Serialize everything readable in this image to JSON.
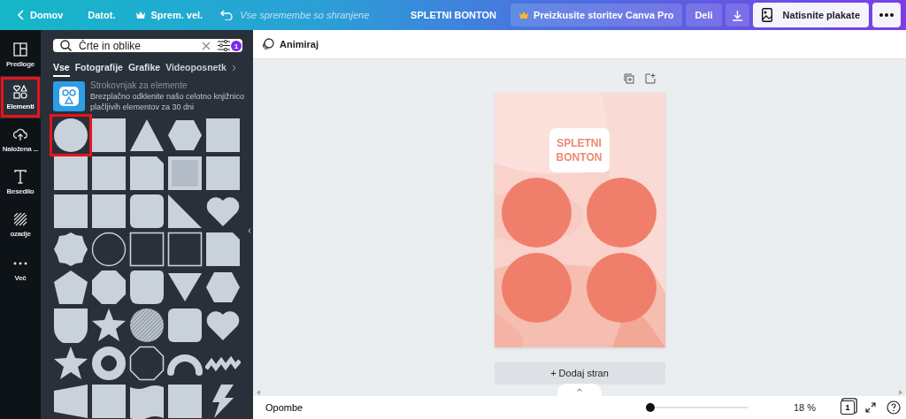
{
  "top_bar": {
    "back": "Domov",
    "file": "Datot.",
    "resize": "Sprem. vel.",
    "save_status": "Vse spremembe so shranjene",
    "design_title": "SPLETNI BONTON",
    "pro_button": "Preizkusite storitev Canva Pro",
    "share_button": "Deli",
    "print_button": "Natisnite plakate"
  },
  "sidebar": {
    "items": [
      {
        "label": "Predloge",
        "selected": false,
        "highlighted": false
      },
      {
        "label": "Elementi",
        "selected": true,
        "highlighted": true
      },
      {
        "label": "Naložena ...",
        "selected": false,
        "highlighted": false
      },
      {
        "label": "Besedilo",
        "selected": false,
        "highlighted": false
      },
      {
        "label": "ozadje",
        "selected": false,
        "highlighted": false
      },
      {
        "label": "Več",
        "selected": false,
        "highlighted": false
      }
    ]
  },
  "elements_panel": {
    "search": {
      "value": "Črte in oblike",
      "filter_count": "1"
    },
    "tabs": [
      {
        "label": "Vse",
        "selected": true
      },
      {
        "label": "Fotografije",
        "selected": false
      },
      {
        "label": "Grafike",
        "selected": false
      },
      {
        "label": "Videoposnetk",
        "selected": false
      }
    ],
    "promo": {
      "title": "Strokovnjak za elemente",
      "text": "Brezplačno odklenite našo celotno knjižnico plačljivih elementov za 30 dni"
    },
    "shapes": [
      {
        "kind": "circle",
        "highlighted": true
      },
      {
        "kind": "square",
        "highlighted": false
      },
      {
        "kind": "triangle",
        "highlighted": false
      },
      {
        "kind": "hexagon",
        "highlighted": false
      },
      {
        "kind": "square",
        "highlighted": false
      },
      {
        "kind": "square",
        "highlighted": false
      },
      {
        "kind": "square",
        "highlighted": false
      },
      {
        "kind": "folded",
        "highlighted": false
      },
      {
        "kind": "framed",
        "highlighted": false
      },
      {
        "kind": "square",
        "highlighted": false
      },
      {
        "kind": "square",
        "highlighted": false
      },
      {
        "kind": "square",
        "highlighted": false
      },
      {
        "kind": "rounded",
        "highlighted": false
      },
      {
        "kind": "right-triangle",
        "highlighted": false
      },
      {
        "kind": "heart",
        "highlighted": false
      },
      {
        "kind": "wavy",
        "highlighted": false
      },
      {
        "kind": "circle-outline",
        "highlighted": false
      },
      {
        "kind": "square-outline",
        "highlighted": false
      },
      {
        "kind": "square-outline",
        "highlighted": false
      },
      {
        "kind": "cut-corner",
        "highlighted": false
      },
      {
        "kind": "pentagon",
        "highlighted": false
      },
      {
        "kind": "octagon",
        "highlighted": false
      },
      {
        "kind": "tab",
        "highlighted": false
      },
      {
        "kind": "down-triangle",
        "highlighted": false
      },
      {
        "kind": "hexagon",
        "highlighted": false
      },
      {
        "kind": "shield",
        "highlighted": false
      },
      {
        "kind": "star",
        "highlighted": false
      },
      {
        "kind": "hatched-circle",
        "highlighted": false
      },
      {
        "kind": "rounded",
        "highlighted": false
      },
      {
        "kind": "heart",
        "highlighted": false
      },
      {
        "kind": "star",
        "highlighted": false
      },
      {
        "kind": "ring",
        "highlighted": false
      },
      {
        "kind": "octagon-outline",
        "highlighted": false
      },
      {
        "kind": "arch",
        "highlighted": false
      },
      {
        "kind": "zigzag",
        "highlighted": false
      },
      {
        "kind": "banner",
        "highlighted": false
      },
      {
        "kind": "square",
        "highlighted": false
      },
      {
        "kind": "wavy-square",
        "highlighted": false
      },
      {
        "kind": "square",
        "highlighted": false
      },
      {
        "kind": "bolt",
        "highlighted": false
      }
    ]
  },
  "editor": {
    "animate_button": "Animiraj",
    "page": {
      "title": "SPLETNI BONTON"
    },
    "add_page_button": "+ Dodaj stran"
  },
  "footer": {
    "notes_button": "Opombe",
    "zoom": {
      "level": 0.0,
      "reading": "18 %"
    },
    "page_count": "1"
  }
}
